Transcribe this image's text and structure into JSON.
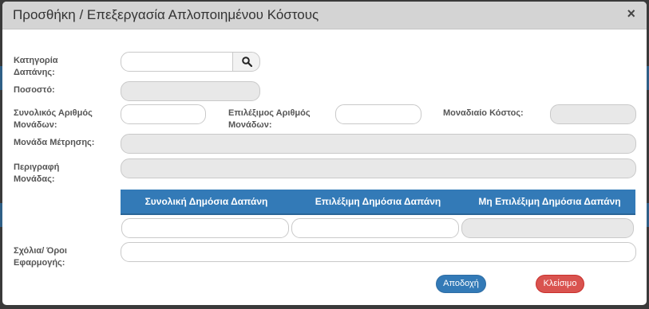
{
  "dialog": {
    "title": "Προσθήκη / Επεξεργασία Απλοποιημένου Κόστους",
    "close_glyph": "×"
  },
  "labels": {
    "category": "Κατηγορία\nΔαπάνης:",
    "percentage": "Ποσοστό:",
    "total_units": "Συνολικός Αριθμός\nΜονάδων:",
    "eligible_units": "Επιλέξιμος Αριθμός\nΜονάδων:",
    "unit_cost": "Μοναδιαίο Κόστος:",
    "measurement_unit": "Μονάδα Μέτρησης:",
    "unit_description": "Περιγραφή\nΜονάδας:",
    "comments": "Σχόλια/ Όροι\nΕφαρμογής:"
  },
  "fields": {
    "category": "",
    "percentage": "",
    "total_units": "",
    "eligible_units": "",
    "unit_cost": "",
    "measurement_unit": "",
    "unit_description": "",
    "comments": ""
  },
  "table": {
    "headers": [
      "Συνολική Δημόσια Δαπάνη",
      "Επιλέξιμη Δημόσια Δαπάνη",
      "Μη Επιλέξιμη Δημόσια Δαπάνη"
    ],
    "values": [
      "",
      "",
      ""
    ]
  },
  "buttons": {
    "accept": "Αποδοχή",
    "close": "Κλείσιμο"
  },
  "colors": {
    "primary": "#337ab7",
    "danger": "#d9534f",
    "header_bg": "#d4d4d4",
    "readonly_bg": "#e8e8e8"
  }
}
